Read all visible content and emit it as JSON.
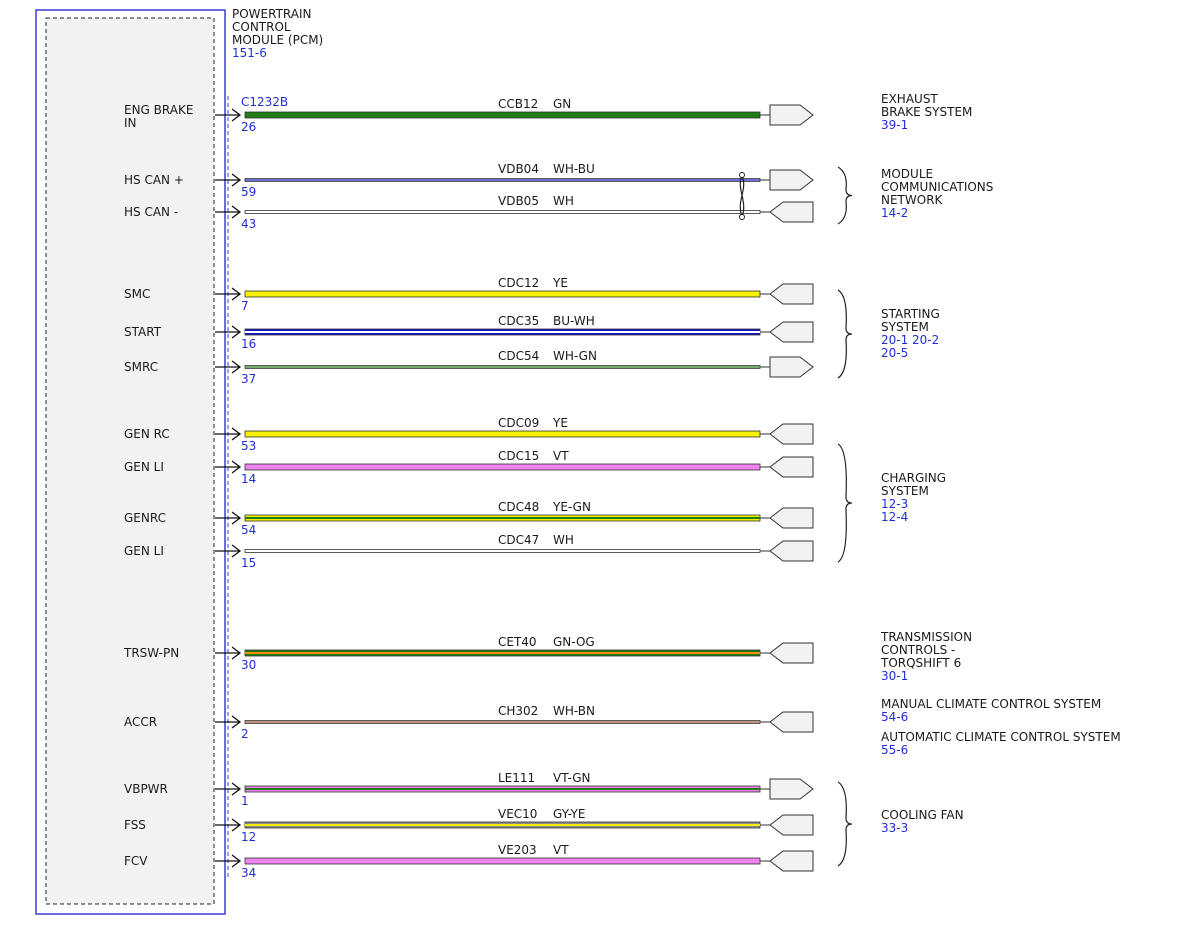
{
  "module": {
    "title_lines": [
      "POWERTRAIN",
      "CONTROL",
      "MODULE (PCM)"
    ],
    "ref": "151-6",
    "connector": "C1232B"
  },
  "colors": {
    "GN": "#1e7d14",
    "WH": "#ffffff",
    "BU": "#1414c8",
    "YE": "#f5f000",
    "VT": "#ee82ee",
    "OG": "#ff8c00",
    "BN": "#a0522d",
    "GY": "#8c8c8c",
    "module_border": "#3c3cdc",
    "module_fill": "#f2f2f2",
    "ref_text": "#1f2fd6"
  },
  "wires": [
    {
      "signal": "ENG BRAKE IN",
      "pin": "26",
      "circuit": "CCB12",
      "color": "GN"
    },
    {
      "signal": "HS CAN +",
      "pin": "59",
      "circuit": "VDB04",
      "color": "WH-BU"
    },
    {
      "signal": "HS CAN -",
      "pin": "43",
      "circuit": "VDB05",
      "color": "WH"
    },
    {
      "signal": "SMC",
      "pin": "7",
      "circuit": "CDC12",
      "color": "YE"
    },
    {
      "signal": "START",
      "pin": "16",
      "circuit": "CDC35",
      "color": "BU-WH"
    },
    {
      "signal": "SMRC",
      "pin": "37",
      "circuit": "CDC54",
      "color": "WH-GN"
    },
    {
      "signal": "GEN RC",
      "pin": "53",
      "circuit": "CDC09",
      "color": "YE"
    },
    {
      "signal": "GEN LI",
      "pin": "14",
      "circuit": "CDC15",
      "color": "VT"
    },
    {
      "signal": "GENRC",
      "pin": "54",
      "circuit": "CDC48",
      "color": "YE-GN"
    },
    {
      "signal": "GEN LI",
      "pin": "15",
      "circuit": "CDC47",
      "color": "WH"
    },
    {
      "signal": "TRSW-PN",
      "pin": "30",
      "circuit": "CET40",
      "color": "GN-OG"
    },
    {
      "signal": "ACCR",
      "pin": "2",
      "circuit": "CH302",
      "color": "WH-BN"
    },
    {
      "signal": "VBPWR",
      "pin": "1",
      "circuit": "LE111",
      "color": "VT-GN"
    },
    {
      "signal": "FSS",
      "pin": "12",
      "circuit": "VEC10",
      "color": "GY-YE"
    },
    {
      "signal": "FCV",
      "pin": "34",
      "circuit": "VE203",
      "color": "VT"
    }
  ],
  "destinations": [
    {
      "lines": [
        "EXHAUST",
        "BRAKE SYSTEM"
      ],
      "refs": [
        "39-1"
      ]
    },
    {
      "lines": [
        "MODULE",
        "COMMUNICATIONS",
        "NETWORK"
      ],
      "refs": [
        "14-2"
      ]
    },
    {
      "lines": [
        "STARTING",
        "SYSTEM"
      ],
      "refs": [
        "20-1  20-2",
        "20-5"
      ]
    },
    {
      "lines": [
        "CHARGING",
        "SYSTEM"
      ],
      "refs": [
        "12-3",
        "12-4"
      ]
    },
    {
      "lines": [
        "TRANSMISSION",
        "CONTROLS -",
        "TORQSHIFT 6"
      ],
      "refs": [
        "30-1"
      ]
    },
    {
      "lines": [
        "MANUAL CLIMATE CONTROL SYSTEM"
      ],
      "refs": [
        "54-6"
      ]
    },
    {
      "lines": [
        "AUTOMATIC CLIMATE CONTROL SYSTEM"
      ],
      "refs": [
        "55-6"
      ]
    },
    {
      "lines": [
        "COOLING FAN"
      ],
      "refs": [
        "33-3"
      ]
    }
  ]
}
